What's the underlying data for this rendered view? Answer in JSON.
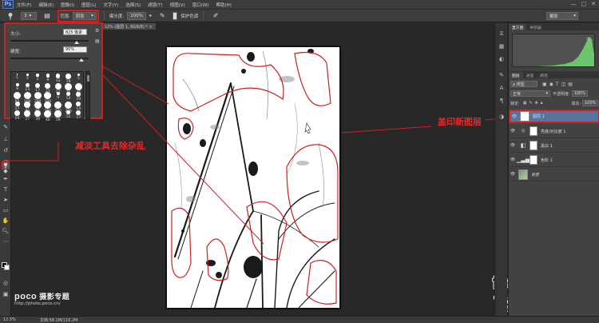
{
  "app": {
    "logo": "Ps"
  },
  "menu": [
    "文件(F)",
    "编辑(E)",
    "图像(I)",
    "图层(L)",
    "文字(Y)",
    "选择(S)",
    "滤镜(T)",
    "视图(V)",
    "窗口(W)",
    "帮助(H)"
  ],
  "window_controls": [
    "—",
    "□",
    "✕"
  ],
  "options": {
    "brush_size": "3",
    "mode_label": "范围:",
    "mode_value": "阴影",
    "exposure_label": "曝光度:",
    "exposure_value": "100%",
    "protect_tone": "保护色调",
    "workspace": "摄影"
  },
  "document_tab": "@ 12% (图层 1, RGB/8) * ×",
  "brush_panel": {
    "size_label": "大小:",
    "size_value": "825 像素",
    "hardness_label": "硬度:",
    "hardness_value": "90%",
    "presets": [
      {
        "n": "1"
      },
      {
        "n": "3"
      },
      {
        "n": "5"
      },
      {
        "n": "9"
      },
      {
        "n": "13"
      },
      {
        "n": "19"
      },
      {
        "n": "5"
      },
      {
        "n": "9"
      },
      {
        "n": "13"
      },
      {
        "n": "17"
      },
      {
        "n": "21"
      },
      {
        "n": "27"
      },
      {
        "n": "35"
      },
      {
        "n": "45"
      },
      {
        "n": "65"
      },
      {
        "n": "100"
      },
      {
        "n": "200"
      },
      {
        "n": "300"
      },
      {
        "n": "9"
      },
      {
        "n": "13"
      },
      {
        "n": "19"
      },
      {
        "n": "17"
      },
      {
        "n": "45"
      },
      {
        "n": "65"
      },
      {
        "n": "100"
      },
      {
        "n": "200"
      },
      {
        "n": "300"
      },
      {
        "n": "14"
      },
      {
        "n": "24"
      },
      {
        "n": "27"
      },
      {
        "n": "39"
      },
      {
        "n": "46"
      },
      {
        "n": "59"
      },
      {
        "n": "11"
      },
      {
        "n": "17"
      },
      {
        "n": "23"
      },
      {
        "n": "36"
      },
      {
        "n": "44"
      },
      {
        "n": "60"
      },
      {
        "n": "14"
      },
      {
        "n": "26"
      },
      {
        "n": "33"
      }
    ]
  },
  "annotations": {
    "left": "减淡工具去除杂乱",
    "right": "盖印新图层"
  },
  "watermark": {
    "poco_brand": "poco",
    "poco_subtitle": "摄影专题",
    "poco_url": "http://photo.poco.cn/",
    "fevte_line1": "fevte.com",
    "fevte_line2": "飞特教程网"
  },
  "status": {
    "zoom": "12.5%",
    "doc_size": "文档:58.1M/116.2M"
  },
  "histogram_tabs": [
    "直方图",
    "导航器"
  ],
  "layers_panel": {
    "tabs": [
      "图层",
      "通道",
      "路径"
    ],
    "kind_label": "ρ 类型",
    "blend_mode": "正常",
    "opacity_label": "不透明度:",
    "opacity_value": "100%",
    "lock_label": "锁定:",
    "fill_label": "填充:",
    "fill_value": "100%",
    "layers": [
      {
        "name": "图层 1",
        "type": "pixel",
        "selected": true
      },
      {
        "name": "亮度/对比度 1",
        "type": "adjust-sun",
        "selected": false
      },
      {
        "name": "黑白 1",
        "type": "adjust-bw",
        "selected": false
      },
      {
        "name": "色阶 1",
        "type": "adjust-levels",
        "selected": false
      },
      {
        "name": "背景",
        "type": "background",
        "selected": false
      }
    ]
  }
}
